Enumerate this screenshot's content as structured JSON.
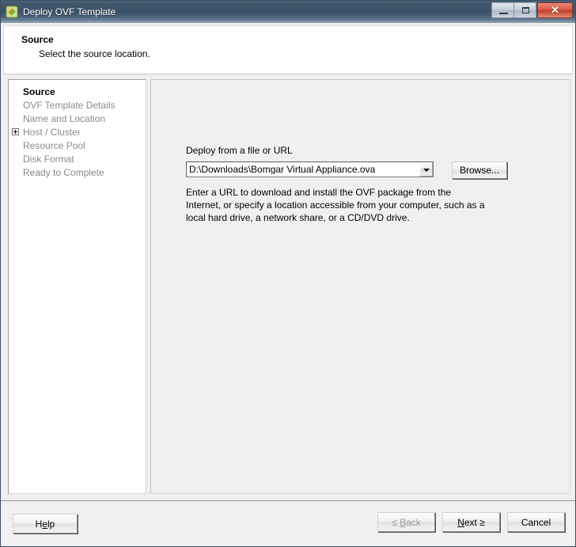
{
  "window": {
    "title": "Deploy OVF Template",
    "icon": "ovf-template-icon",
    "controls": {
      "minimize": "minimize-icon",
      "maximize": "maximize-icon",
      "close_glyph": "✕"
    }
  },
  "header": {
    "title": "Source",
    "subtitle": "Select the source location."
  },
  "sidebar": {
    "items": [
      {
        "label": "Source",
        "active": true,
        "expandable": false
      },
      {
        "label": "OVF Template Details",
        "active": false,
        "expandable": false
      },
      {
        "label": "Name and Location",
        "active": false,
        "expandable": false
      },
      {
        "label": "Host / Cluster",
        "active": false,
        "expandable": true
      },
      {
        "label": "Resource Pool",
        "active": false,
        "expandable": false
      },
      {
        "label": "Disk Format",
        "active": false,
        "expandable": false
      },
      {
        "label": "Ready to Complete",
        "active": false,
        "expandable": false
      }
    ]
  },
  "main": {
    "field_label": "Deploy from a file or URL",
    "source_value": "D:\\Downloads\\Bomgar Virtual Appliance.ova",
    "source_placeholder": "",
    "browse_label": "Browse...",
    "description": "Enter a URL to download and install the OVF package from the Internet, or specify a location accessible from your computer, such as a local hard drive, a network share, or a CD/DVD drive."
  },
  "footer": {
    "help": {
      "prefix": "H",
      "accel": "e",
      "suffix": "lp"
    },
    "back": {
      "prefix": "≤ ",
      "accel": "B",
      "suffix": "ack",
      "disabled": true
    },
    "next": {
      "prefix": "",
      "accel": "N",
      "suffix": "ext ≥",
      "disabled": false
    },
    "cancel": {
      "label": "Cancel"
    }
  },
  "colors": {
    "titlebar": "#3a5066",
    "close_button": "#c13f28",
    "content_bg": "#f0f0f0",
    "sidebar_bg": "#ffffff",
    "active_nav_text": "#000000",
    "inactive_nav_text": "#8a8a8a"
  }
}
